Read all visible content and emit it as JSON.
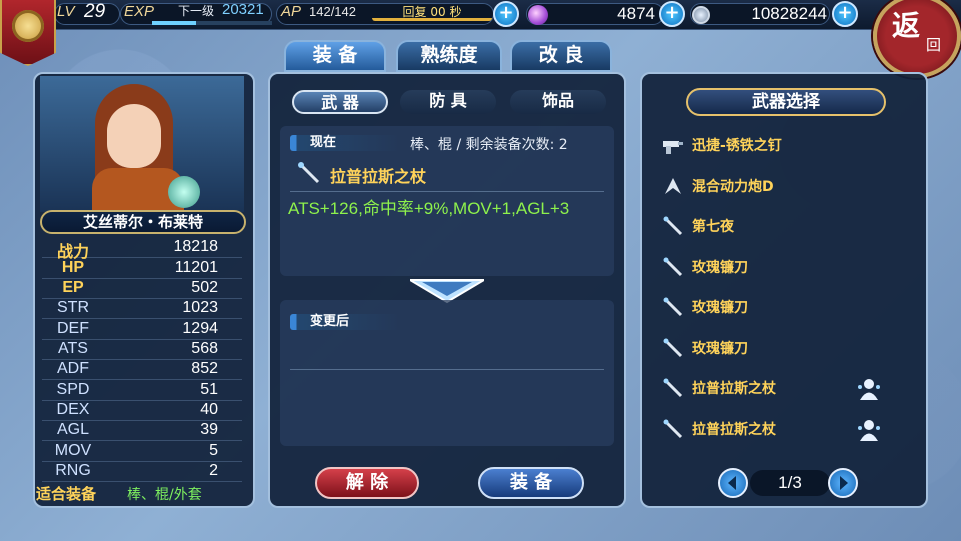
{
  "header": {
    "lv_label": "LV",
    "lv_value": "29",
    "exp_label": "EXP",
    "exp_next_label": "下一级",
    "exp_value": "20321",
    "exp_progress": 0.37,
    "ap_label": "AP",
    "ap_value": "142/142",
    "recover_text": "回复 00 秒",
    "gems": "4874",
    "coins": "10828244",
    "back_label": "返",
    "back_sub": "回"
  },
  "tabs": [
    {
      "label": "装 备",
      "active": true
    },
    {
      "label": "熟练度",
      "active": false
    },
    {
      "label": "改 良",
      "active": false
    }
  ],
  "character": {
    "name": "艾丝蒂尔・布莱特",
    "stats": [
      {
        "label": "战力",
        "value": "18218",
        "highlight": true
      },
      {
        "label": "HP",
        "value": "11201",
        "highlight": true
      },
      {
        "label": "EP",
        "value": "502",
        "highlight": true
      },
      {
        "label": "STR",
        "value": "1023",
        "highlight": false
      },
      {
        "label": "DEF",
        "value": "1294",
        "highlight": false
      },
      {
        "label": "ATS",
        "value": "568",
        "highlight": false
      },
      {
        "label": "ADF",
        "value": "852",
        "highlight": false
      },
      {
        "label": "SPD",
        "value": "51",
        "highlight": false
      },
      {
        "label": "DEX",
        "value": "40",
        "highlight": false
      },
      {
        "label": "AGL",
        "value": "39",
        "highlight": false
      },
      {
        "label": "MOV",
        "value": "5",
        "highlight": false
      },
      {
        "label": "RNG",
        "value": "2",
        "highlight": false
      }
    ],
    "equip_label": "适合装备",
    "equip_value": "棒、棍/外套"
  },
  "equipment": {
    "subtabs": [
      {
        "label": "武 器",
        "active": true
      },
      {
        "label": "防 具",
        "active": false
      },
      {
        "label": "饰品",
        "active": false
      }
    ],
    "current_label": "现在",
    "current_type": "棒、棍 / 剩余装备次数: 2",
    "current_weapon": "拉普拉斯之杖",
    "current_stats": "ATS+126,命中率+9%,MOV+1,AGL+3",
    "after_label": "变更后",
    "release_button": "解 除",
    "equip_button": "装 备"
  },
  "weapon_select": {
    "title": "武器选择",
    "items": [
      {
        "name": "迅捷-锈铁之钉",
        "icon": "gun-icon",
        "equipped": false
      },
      {
        "name": "混合动力炮D",
        "icon": "cannon-icon",
        "equipped": false
      },
      {
        "name": "第七夜",
        "icon": "staff-icon",
        "equipped": false
      },
      {
        "name": "玫瑰镰刀",
        "icon": "staff-icon",
        "equipped": false
      },
      {
        "name": "玫瑰镰刀",
        "icon": "staff-icon",
        "equipped": false
      },
      {
        "name": "玫瑰镰刀",
        "icon": "staff-icon",
        "equipped": false
      },
      {
        "name": "拉普拉斯之杖",
        "icon": "staff-icon",
        "equipped": true
      },
      {
        "name": "拉普拉斯之杖",
        "icon": "staff-icon",
        "equipped": true
      }
    ],
    "page": "1/3"
  },
  "colors": {
    "gold_text": "#ffd35a",
    "green_text": "#8ef24c",
    "panel_bg": "#11213a",
    "accent_blue": "#3a86d6"
  }
}
